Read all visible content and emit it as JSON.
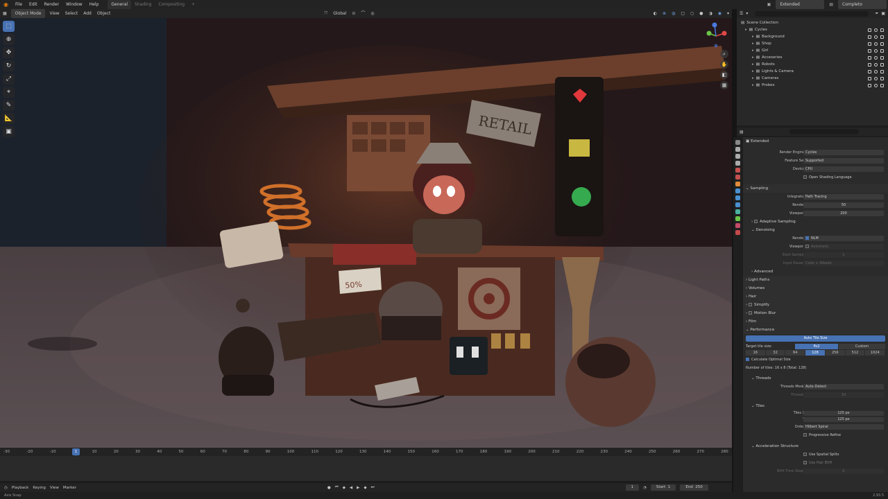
{
  "menu": {
    "items": [
      "File",
      "Edit",
      "Render",
      "Window",
      "Help"
    ],
    "workspaces": [
      "General",
      "Shading",
      "Compositing"
    ],
    "add_tab": "+",
    "scene": "Extended",
    "view_layer": "Completo"
  },
  "viewport_header": {
    "mode": "Object Mode",
    "menus": [
      "View",
      "Select",
      "Add",
      "Object"
    ],
    "orientation": "Global"
  },
  "timeline": {
    "ticks": [
      "-30",
      "-20",
      "-10",
      "0",
      "10",
      "20",
      "30",
      "40",
      "50",
      "60",
      "70",
      "80",
      "90",
      "100",
      "110",
      "120",
      "130",
      "140",
      "150",
      "160",
      "170",
      "180",
      "190",
      "200",
      "210",
      "220",
      "230",
      "240",
      "250",
      "260",
      "270",
      "280"
    ],
    "current_frame_marker": "1",
    "menus": [
      "Playback",
      "Keying",
      "View",
      "Marker"
    ],
    "current_frame": "1",
    "start_label": "Start",
    "start": "1",
    "end_label": "End",
    "end": "250"
  },
  "status": {
    "left": "Axis Snap",
    "right": "2.93.5"
  },
  "outliner": {
    "root": "Scene Collection",
    "items": [
      {
        "label": "Cycles",
        "indent": 0
      },
      {
        "label": "Background",
        "indent": 1
      },
      {
        "label": "Shop",
        "indent": 1
      },
      {
        "label": "Girl",
        "indent": 1
      },
      {
        "label": "Accesories",
        "indent": 1
      },
      {
        "label": "Robots",
        "indent": 1
      },
      {
        "label": "Lights & Camera",
        "indent": 1
      },
      {
        "label": "Cameras",
        "indent": 1
      },
      {
        "label": "Probes",
        "indent": 1
      }
    ]
  },
  "properties": {
    "scene_name": "Extended",
    "render_engine_label": "Render Engine",
    "render_engine": "Cycles",
    "feature_set_label": "Feature Set",
    "feature_set": "Supported",
    "device_label": "Device",
    "device": "CPU",
    "osl": "Open Shading Language",
    "sampling": "Sampling",
    "integrator_label": "Integrator",
    "integrator": "Path Tracing",
    "render_label": "Render",
    "render_samples": "50",
    "viewport_label": "Viewport",
    "viewport_samples": "200",
    "adaptive": "Adaptive Sampling",
    "denoising": "Denoising",
    "denoise_render_label": "Render",
    "denoise_render": "NLM",
    "denoise_viewport_label": "Viewport",
    "denoise_viewport": "Automatic",
    "start_sample_label": "Start Sample",
    "start_sample": "1",
    "input_passes_label": "Input Passes",
    "input_passes": "Color + Albedo",
    "advanced": "Advanced",
    "light_paths": "Light Paths",
    "volumes": "Volumes",
    "hair": "Hair",
    "simplify": "Simplify",
    "motion_blur": "Motion Blur",
    "film": "Film",
    "performance": "Performance",
    "auto_tile": "Auto Tile Size",
    "target_tile_label": "Target tile size:",
    "po2": "Po2",
    "custom": "Custom",
    "tile_sizes": [
      "16",
      "32",
      "64",
      "128",
      "256",
      "512",
      "1024"
    ],
    "calc_optimal": "Calculate Optimal Size",
    "num_tiles": "Number of tiles: 16 x 8 (Total: 128)",
    "threads": "Threads",
    "threads_mode_label": "Threads Mode",
    "threads_mode": "Auto-Detect",
    "threads_count_label": "Threads",
    "threads_count": "10",
    "tiles": "Tiles",
    "tiles_x_label": "Tiles X",
    "tiles_x": "125 px",
    "tiles_y_label": "Y",
    "tiles_y": "125 px",
    "order_label": "Order",
    "order": "Hilbert Spiral",
    "progressive": "Progressive Refine",
    "accel": "Acceleration Structure",
    "spatial_splits": "Use Spatial Splits",
    "hair_bvh": "Use Hair BVH",
    "bvh_steps_label": "BVH Time Steps",
    "bvh_steps": "0"
  },
  "scene_text": {
    "sign": "RETAIL",
    "price_tag": "50%"
  },
  "colors": {
    "accent": "#4772b3",
    "heart": "#e0383c",
    "green_light": "#3cc45a",
    "yellow_light": "#e8d34a"
  }
}
